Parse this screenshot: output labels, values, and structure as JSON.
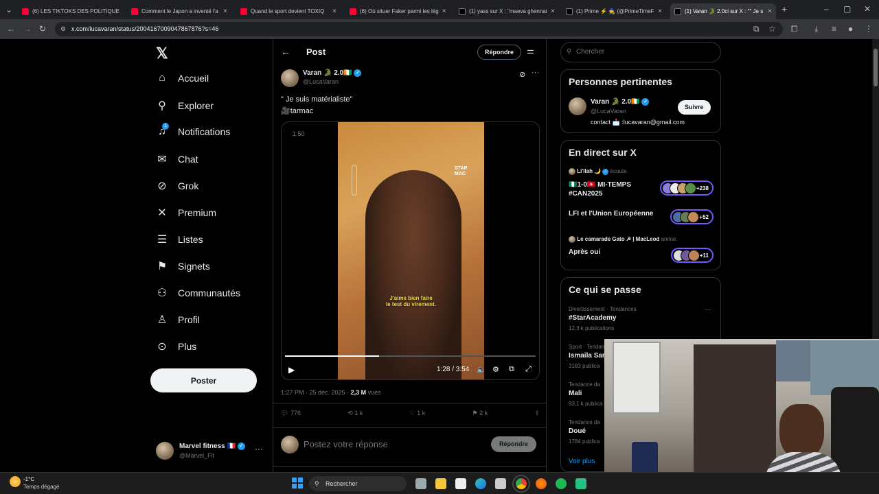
{
  "browser": {
    "tabs": [
      {
        "title": "(6) LES TIKTOKS DES POLITIQUE",
        "kind": "youtube"
      },
      {
        "title": "Comment le Japon a inventé l'a",
        "kind": "youtube"
      },
      {
        "title": "Quand le sport devient TOXIQ",
        "kind": "youtube"
      },
      {
        "title": "(6) Où situer Faker parmi les lég",
        "kind": "youtube"
      },
      {
        "title": "(1) yass sur X : \"maeva ghennai",
        "kind": "x"
      },
      {
        "title": "(1) Prime ⚡ 🧙 (@PrimeTimeF",
        "kind": "x"
      },
      {
        "title": "(1) Varan 🐊 2.0ci sur X : \"\" Je s",
        "kind": "x"
      }
    ],
    "url": "x.com/lucavaran/status/2004167009047867876?s=46"
  },
  "nav": {
    "items": [
      {
        "label": "Accueil",
        "icon": "home-icon"
      },
      {
        "label": "Explorer",
        "icon": "search-icon"
      },
      {
        "label": "Notifications",
        "icon": "bell-icon",
        "badge": "1"
      },
      {
        "label": "Chat",
        "icon": "mail-icon"
      },
      {
        "label": "Grok",
        "icon": "grok-icon"
      },
      {
        "label": "Premium",
        "icon": "x-logo-icon"
      },
      {
        "label": "Listes",
        "icon": "list-icon"
      },
      {
        "label": "Signets",
        "icon": "bookmark-icon"
      },
      {
        "label": "Communautés",
        "icon": "people-icon"
      },
      {
        "label": "Profil",
        "icon": "person-icon"
      },
      {
        "label": "Plus",
        "icon": "more-circle-icon"
      }
    ],
    "post_button": "Poster",
    "account": {
      "name": "Marvel fitness 🇫🇷",
      "handle": "@Marvel_Flt"
    }
  },
  "post": {
    "header_title": "Post",
    "reply_button": "Répondre",
    "author_name": "Varan 🐊 2.0🇨🇮",
    "author_handle": "@LucaVaran",
    "text_line1": "\" Je suis matérialiste\"",
    "text_line2": "🎥tarmac",
    "video": {
      "speed_label": "1.50",
      "subtitle_line1": "J'aime bien faire",
      "subtitle_line2": "le test du virement.",
      "time": "1:28 / 3:54",
      "progress": 0.376,
      "watermark": "STAR MAC"
    },
    "timestamp": "1:27 PM · 25 déc. 2025 · ",
    "views_count": "2,3 M",
    "views_label": " vues",
    "replies": "776",
    "reposts": "1 k",
    "likes": "1 k",
    "bookmarks": "2 k",
    "reply_placeholder": "Postez votre réponse",
    "reply_submit": "Répondre"
  },
  "sidebar": {
    "search_placeholder": "Chercher",
    "relevant": {
      "title": "Personnes pertinentes",
      "name": "Varan 🐊 2.0🇨🇮",
      "handle": "@LucaVaran",
      "bio": "contact 📩 :lucavaran@gmail.com",
      "follow": "Suivre"
    },
    "live": {
      "title": "En direct sur X",
      "spaces": [
        {
          "host": "Li'llah 🌙",
          "host_action": " écoute.",
          "title": "🇳🇬1-0🇹🇳 MI-TEMPS #CAN2025",
          "count": "+238"
        },
        {
          "host": "",
          "host_action": "",
          "title": "LFI et l'Union Européenne",
          "count": "+52"
        },
        {
          "host": "Le camarade Gato ☭ | MacLeod",
          "host_action": " anime.",
          "title": "Après oui",
          "count": "+11"
        }
      ]
    },
    "trends": {
      "title": "Ce qui se passe",
      "items": [
        {
          "meta": "Divertissement · Tendances",
          "name": "#StarAcademy",
          "count": "12,3 k publications"
        },
        {
          "meta": "Sport · Tendan",
          "name": "Ismaila Sar",
          "count": "3183 publica"
        },
        {
          "meta": "Tendance da",
          "name": "Mali",
          "count": "93,1 k publica"
        },
        {
          "meta": "Tendance da",
          "name": "Doué",
          "count": "1784 publica"
        }
      ],
      "more": "Voir plus"
    }
  },
  "taskbar": {
    "weather_temp": "-1°C",
    "weather_desc": "Temps dégagé",
    "search_placeholder": "Rechercher"
  },
  "colors": {
    "accent": "#1d9bf0",
    "space_border": "#7856ff",
    "youtube": "#ff0033"
  }
}
